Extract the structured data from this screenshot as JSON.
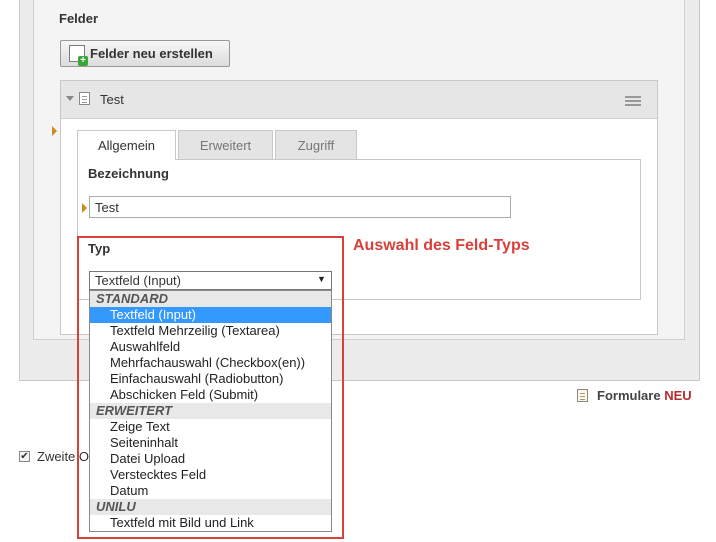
{
  "section": {
    "heading": "Felder",
    "new_fields_button": "Felder neu erstellen"
  },
  "field": {
    "title": "Test",
    "tabs": [
      "Allgemein",
      "Erweitert",
      "Zugriff"
    ],
    "bezeichnung_label": "Bezeichnung",
    "bezeichnung_value": "Test",
    "typ_label": "Typ",
    "typ_selected": "Textfeld (Input)"
  },
  "dropdown": {
    "groups": [
      {
        "label": "STANDARD",
        "options": [
          "Textfeld (Input)",
          "Textfeld Mehrzeilig (Textarea)",
          "Auswahlfeld",
          "Mehrfachauswahl (Checkbox(en))",
          "Einfachauswahl (Radiobutton)",
          "Abschicken Feld (Submit)"
        ]
      },
      {
        "label": "ERWEITERT",
        "options": [
          "Zeige Text",
          "Seiteninhalt",
          "Datei Upload",
          "Verstecktes Feld",
          "Datum"
        ]
      },
      {
        "label": "UNILU",
        "options": [
          "Textfeld mit Bild und Link"
        ]
      }
    ],
    "highlighted": "Textfeld (Input)"
  },
  "annotation": {
    "text": "Auswahl des Feld-Typs",
    "color": "#d9403a"
  },
  "footer": {
    "formulare_label": "Formulare",
    "neu_label": "NEU",
    "checkbox_label": "Zweite O",
    "checkbox_checked": true
  },
  "colors": {
    "selection": "#3399ff",
    "accent_marker": "#d08a1f"
  },
  "icons": [
    "add-fields-icon",
    "collapse-arrow-icon",
    "document-icon",
    "drag-menu-icon",
    "dropdown-arrow-icon",
    "form-icon",
    "checkbox-icon"
  ]
}
